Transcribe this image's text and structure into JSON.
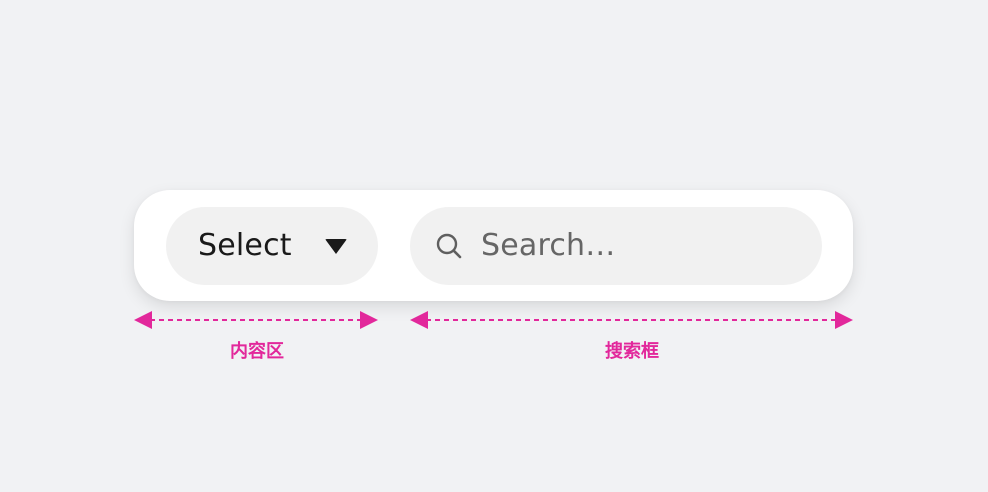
{
  "select": {
    "label": "Select"
  },
  "search": {
    "placeholder": "Search…"
  },
  "annotations": {
    "content_area_label": "内容区",
    "search_box_label": "搜索框"
  },
  "colors": {
    "background": "#f1f2f4",
    "toolbar_bg": "#ffffff",
    "control_bg": "#f1f1f1",
    "text": "#1a1a1a",
    "placeholder": "#666666",
    "annotation": "#e2289b"
  },
  "icons": {
    "search": "search-icon",
    "dropdown": "caret-down-icon"
  }
}
